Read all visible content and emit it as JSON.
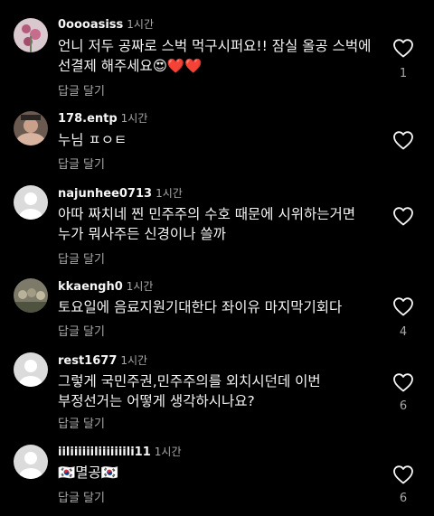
{
  "reply_label": "답글 달기",
  "comments": [
    {
      "username": "0oooasiss",
      "time": "1시간",
      "text": "언니 저두 공짜로 스벅 먹구시퍼요!! 잠실 올공 스벅에 선결제 해주세요😍❤️❤️",
      "likes": "1",
      "avatar": "photo-flowers"
    },
    {
      "username": "178.entp",
      "time": "1시간",
      "text": "누님 ㅍㅇㅌ",
      "likes": "",
      "avatar": "photo-person"
    },
    {
      "username": "najunhee0713",
      "time": "1시간",
      "text": "아따 짜치네 찐 민주주의 수호 때문에 시위하는거면 누가 뭐사주든 신경이나 쓸까",
      "likes": "",
      "avatar": "default"
    },
    {
      "username": "kkaengh0",
      "time": "1시간",
      "text": "토요일에 음료지원기대한다 좌이유 마지막기회다",
      "likes": "4",
      "avatar": "photo-group"
    },
    {
      "username": "rest1677",
      "time": "1시간",
      "text": "그렇게 국민주권,민주주의를 외치시던데 이번 부정선거는 어떻게 생각하시나요?",
      "likes": "6",
      "avatar": "default"
    },
    {
      "username": "iiliiiiiiliiiiiiili11",
      "time": "1시간",
      "text": "🇰🇷멸공🇰🇷",
      "likes": "6",
      "avatar": "default"
    }
  ]
}
